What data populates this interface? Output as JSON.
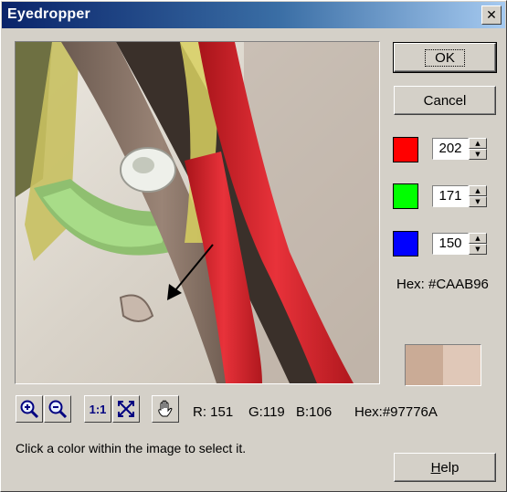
{
  "window": {
    "title": "Eyedropper",
    "close_label": "✕"
  },
  "buttons": {
    "ok": "OK",
    "cancel": "Cancel",
    "help_first": "H",
    "help_rest": "elp"
  },
  "picked": {
    "r": "202",
    "g": "171",
    "b": "150",
    "hex_label": "Hex: #CAAB96",
    "red_swatch": "#ff0000",
    "green_swatch": "#00ff00",
    "blue_swatch": "#0000ff",
    "new_color": "#caab96",
    "old_color": "#e0c8b8"
  },
  "toolbar": {
    "one_to_one": "1:1"
  },
  "readout": {
    "r": "R: 151",
    "g": "G:119",
    "b": "B:106",
    "hex": "Hex:#97776A"
  },
  "hint": "Click a color within the image to select it."
}
